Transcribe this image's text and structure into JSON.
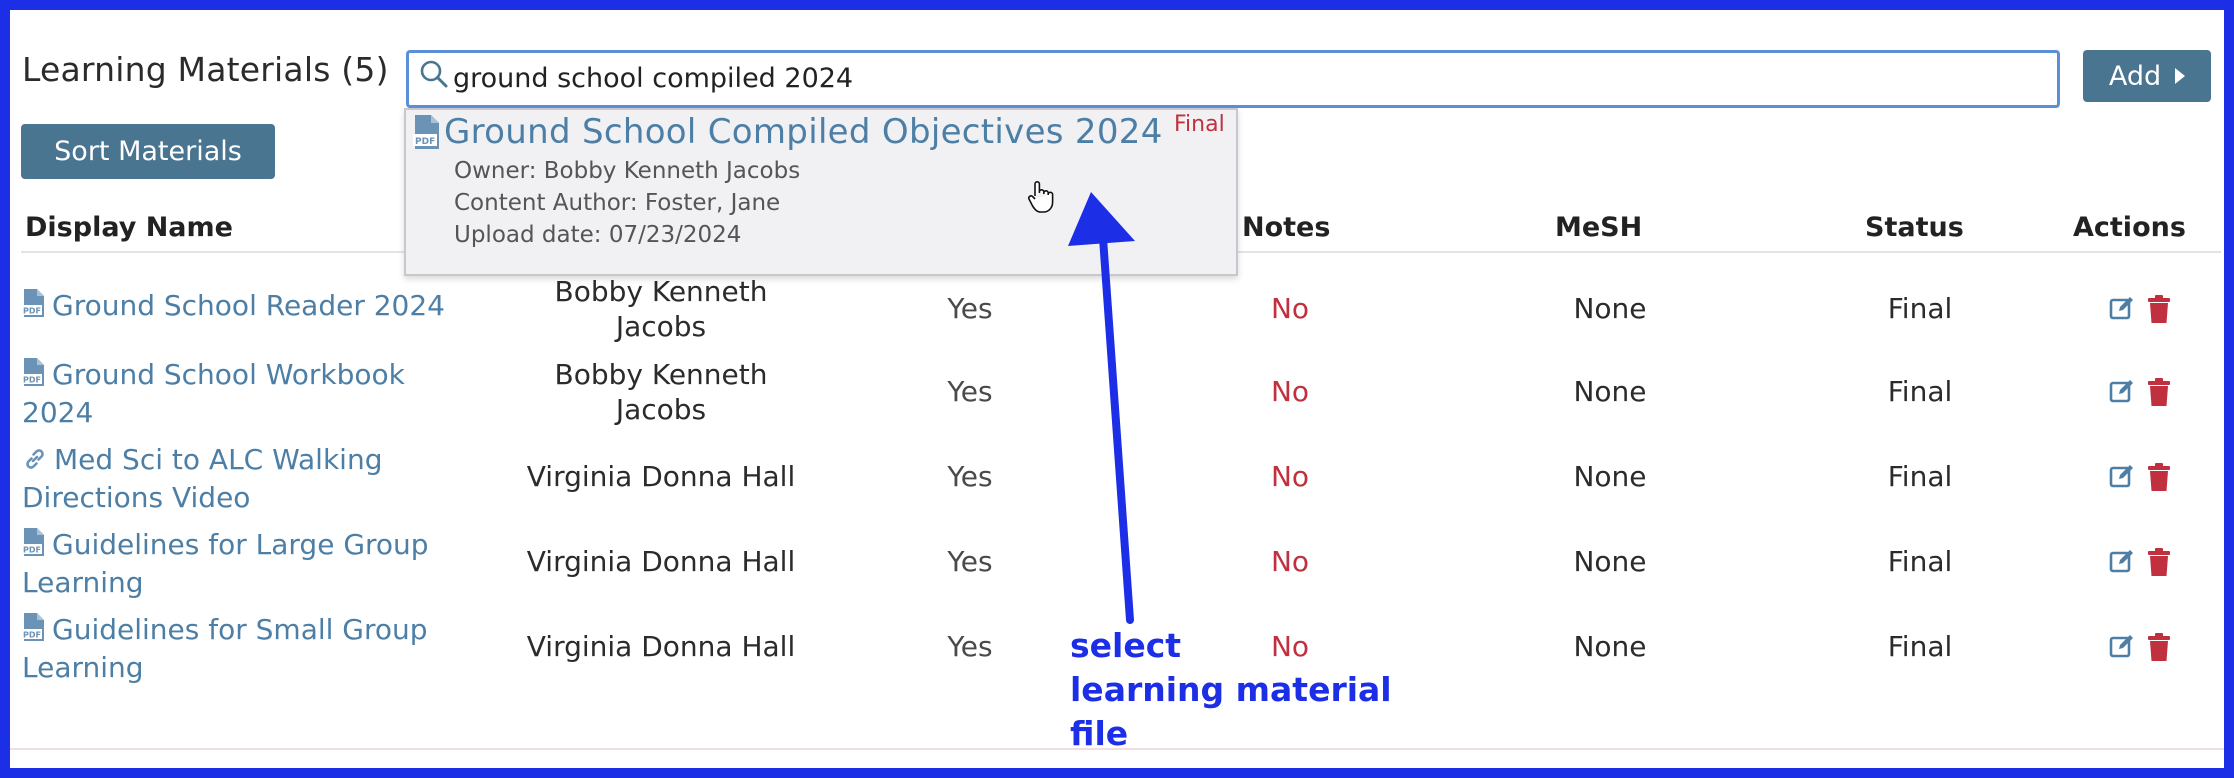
{
  "header": {
    "title": "Learning Materials (5)",
    "add_label": "Add",
    "sort_label": "Sort Materials"
  },
  "search": {
    "value": "ground school compiled 2024"
  },
  "table": {
    "columns": [
      "Display Name",
      "Notes",
      "MeSH",
      "Status",
      "Actions"
    ],
    "rows": [
      {
        "icon": "pdf-file-icon",
        "name_lines": [
          "Ground School Reader 2024"
        ],
        "owner_lines": [
          "Bobby Kenneth",
          "Jacobs"
        ],
        "required": "Yes",
        "notes": "No",
        "mesh": "None",
        "status": "Final"
      },
      {
        "icon": "pdf-file-icon",
        "name_lines": [
          "Ground School Workbook",
          "2024"
        ],
        "owner_lines": [
          "Bobby Kenneth",
          "Jacobs"
        ],
        "required": "Yes",
        "notes": "No",
        "mesh": "None",
        "status": "Final"
      },
      {
        "icon": "link-icon",
        "name_lines": [
          "Med Sci to ALC Walking",
          "Directions Video"
        ],
        "owner_lines": [
          "Virginia Donna Hall"
        ],
        "required": "Yes",
        "notes": "No",
        "mesh": "None",
        "status": "Final"
      },
      {
        "icon": "pdf-file-icon",
        "name_lines": [
          "Guidelines for Large Group",
          "Learning"
        ],
        "owner_lines": [
          "Virginia Donna Hall"
        ],
        "required": "Yes",
        "notes": "No",
        "mesh": "None",
        "status": "Final"
      },
      {
        "icon": "pdf-file-icon",
        "name_lines": [
          "Guidelines for Small Group",
          "Learning"
        ],
        "owner_lines": [
          "Virginia Donna Hall"
        ],
        "required": "Yes",
        "notes": "No",
        "mesh": "None",
        "status": "Final"
      }
    ]
  },
  "dropdown": {
    "title": "Ground School Compiled Objectives 2024",
    "badge": "Final",
    "owner": "Owner: Bobby Kenneth Jacobs",
    "author": "Content Author: Foster, Jane",
    "upload": "Upload date: 07/23/2024"
  },
  "annotation": {
    "text": "select\nlearning material\nfile"
  },
  "colors": {
    "accent": "#4a7590",
    "link": "#4d7fa6",
    "danger": "#c0303f",
    "annotation": "#1c2fe6",
    "focus": "#5b8fd8"
  }
}
